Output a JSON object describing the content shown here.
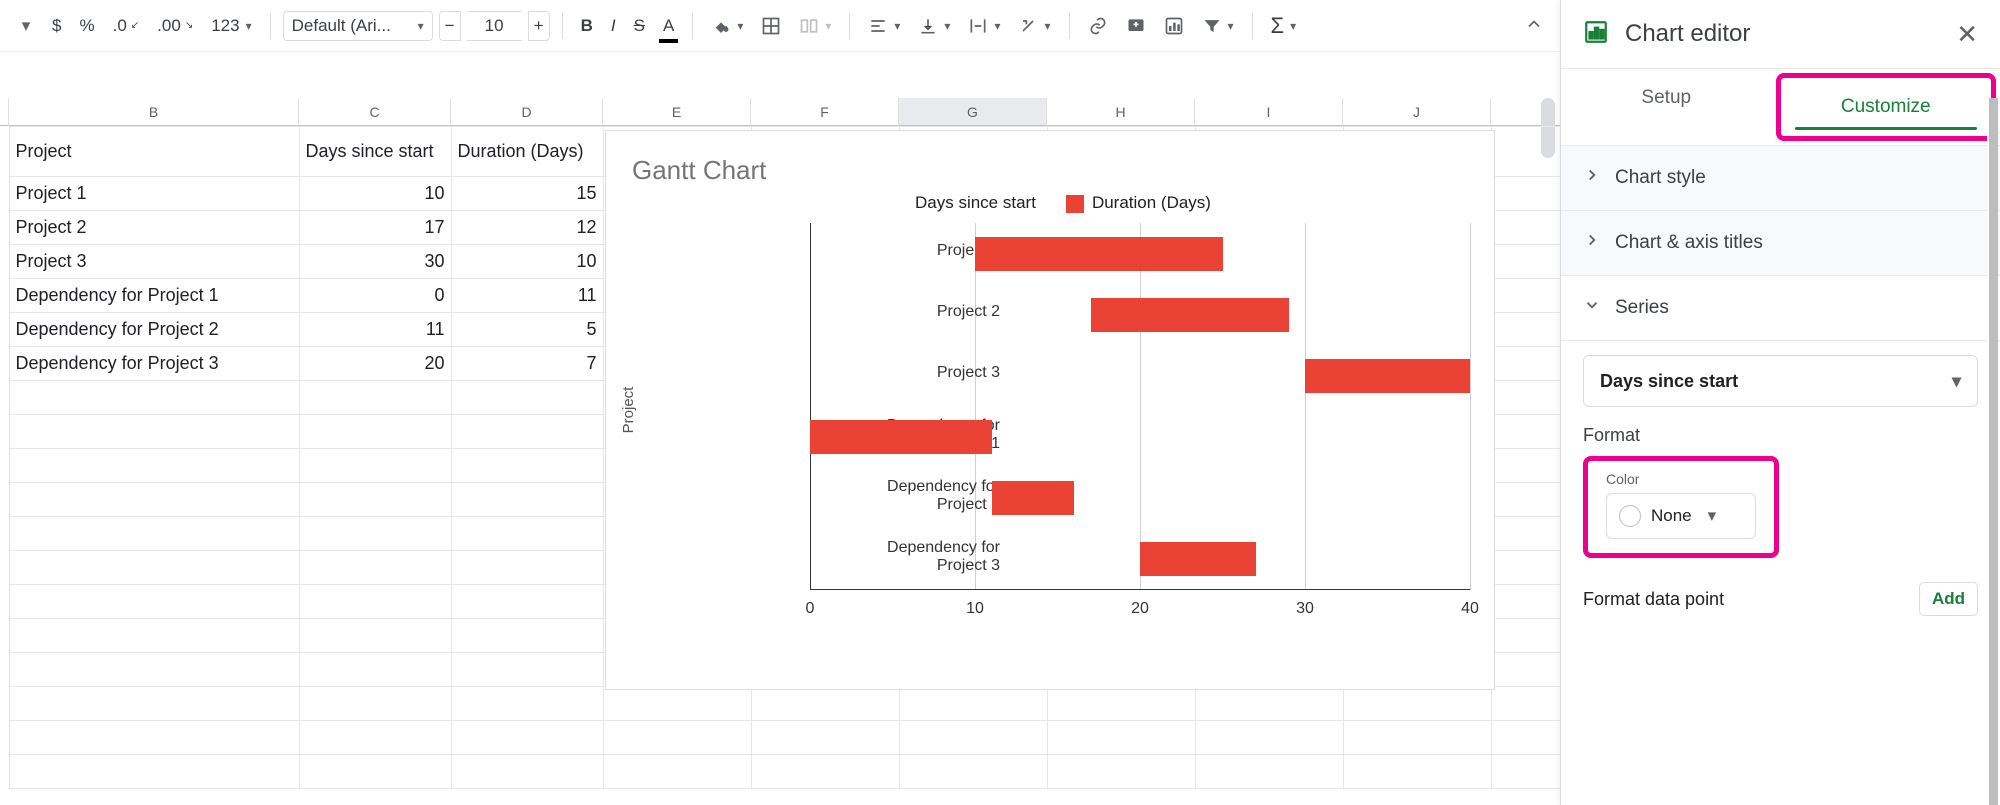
{
  "toolbar": {
    "currency": "$",
    "percent": "%",
    "dec_dec": ".0",
    "dec_inc": ".00",
    "more_formats": "123",
    "font_name": "Default (Ari...",
    "font_size": "10",
    "bold": "B",
    "italic": "I",
    "strike": "S",
    "text_color": "A",
    "collapse_hint": "^"
  },
  "columns": [
    "B",
    "C",
    "D",
    "E",
    "F",
    "G",
    "H",
    "I",
    "J",
    ""
  ],
  "active_col": "G",
  "sheet": {
    "header_row": [
      "Project",
      "Days since start",
      "Duration (Days)",
      "",
      "",
      "",
      "",
      "",
      "",
      ""
    ],
    "rows": [
      [
        "Project 1",
        "10",
        "15",
        "",
        "",
        "",
        "",
        "",
        "",
        ""
      ],
      [
        "Project 2",
        "17",
        "12",
        "",
        "",
        "",
        "",
        "",
        "",
        ""
      ],
      [
        "Project 3",
        "30",
        "10",
        "",
        "",
        "",
        "",
        "",
        "",
        ""
      ],
      [
        "Dependency for Project 1",
        "0",
        "11",
        "",
        "",
        "",
        "",
        "",
        "",
        ""
      ],
      [
        "Dependency for Project 2",
        "11",
        "5",
        "",
        "",
        "",
        "",
        "",
        "",
        ""
      ],
      [
        "Dependency for Project 3",
        "20",
        "7",
        "",
        "",
        "",
        "",
        "",
        "",
        ""
      ],
      [
        "",
        "",
        "",
        "",
        "",
        "",
        "",
        "",
        "",
        ""
      ],
      [
        "",
        "",
        "",
        "",
        "",
        "",
        "",
        "",
        "",
        ""
      ],
      [
        "",
        "",
        "",
        "",
        "",
        "",
        "",
        "",
        "",
        ""
      ],
      [
        "",
        "",
        "",
        "",
        "",
        "",
        "",
        "",
        "",
        ""
      ],
      [
        "",
        "",
        "",
        "",
        "",
        "",
        "",
        "",
        "",
        ""
      ],
      [
        "",
        "",
        "",
        "",
        "",
        "",
        "",
        "",
        "",
        ""
      ],
      [
        "",
        "",
        "",
        "",
        "",
        "",
        "",
        "",
        "",
        ""
      ],
      [
        "",
        "",
        "",
        "",
        "",
        "",
        "",
        "",
        "",
        ""
      ],
      [
        "",
        "",
        "",
        "",
        "",
        "",
        "",
        "",
        "",
        ""
      ],
      [
        "",
        "",
        "",
        "",
        "",
        "",
        "",
        "",
        "",
        ""
      ],
      [
        "",
        "",
        "",
        "",
        "",
        "",
        "",
        "",
        "",
        ""
      ],
      [
        "",
        "",
        "",
        "",
        "",
        "",
        "",
        "",
        "",
        ""
      ]
    ]
  },
  "chart_data": {
    "type": "bar",
    "title": "Gantt Chart",
    "ylabel": "Project",
    "xticks": [
      0,
      10,
      20,
      30,
      40
    ],
    "xmax": 40,
    "legend": [
      "Days since start",
      "Duration (Days)"
    ],
    "categories": [
      "Project 1",
      "Project 2",
      "Project 3",
      "Dependency for Project 1",
      "Dependency for Project 2",
      "Dependency for Project 3"
    ],
    "series": [
      {
        "name": "Days since start",
        "values": [
          10,
          17,
          30,
          0,
          11,
          20
        ],
        "color": "none"
      },
      {
        "name": "Duration (Days)",
        "values": [
          15,
          12,
          10,
          11,
          5,
          7
        ],
        "color": "#ea4335"
      }
    ]
  },
  "panel": {
    "title": "Chart editor",
    "tab_setup": "Setup",
    "tab_customize": "Customize",
    "acc_chart_style": "Chart style",
    "acc_axis_titles": "Chart & axis titles",
    "acc_series": "Series",
    "series_select": "Days since start",
    "format_label": "Format",
    "color_label": "Color",
    "color_value": "None",
    "format_dp": "Format data point",
    "add_btn": "Add"
  }
}
